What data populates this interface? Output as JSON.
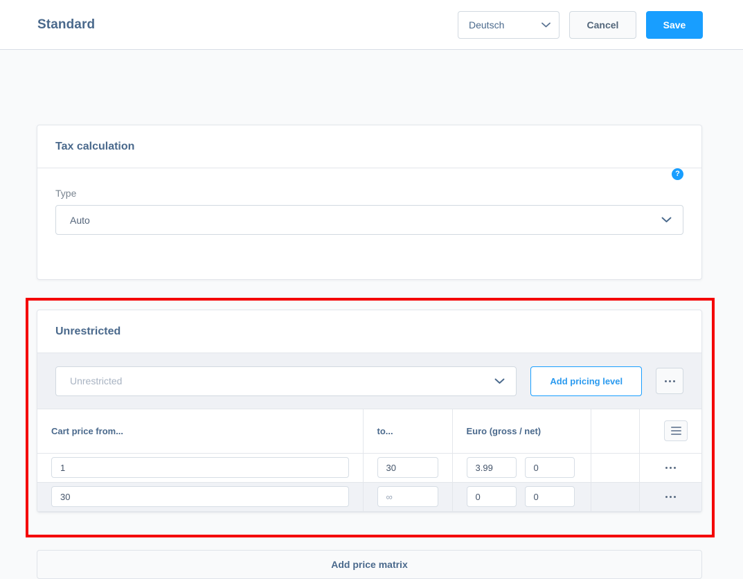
{
  "header": {
    "title": "Standard",
    "language": "Deutsch",
    "cancel_label": "Cancel",
    "save_label": "Save"
  },
  "tax_card": {
    "title": "Tax calculation",
    "type_label": "Type",
    "type_value": "Auto",
    "help_glyph": "?"
  },
  "unrestricted_card": {
    "title": "Unrestricted",
    "rule_select_value": "Unrestricted",
    "add_pricing_level_label": "Add pricing level",
    "table": {
      "headers": [
        "Cart price from...",
        "to...",
        "Euro (gross / net)",
        "",
        ""
      ],
      "rows": [
        {
          "from": "1",
          "to": "30",
          "gross": "3.99",
          "net": "0"
        },
        {
          "from": "30",
          "to": "∞",
          "gross": "0",
          "net": "0"
        }
      ]
    }
  },
  "footer": {
    "add_price_matrix_label": "Add price matrix"
  },
  "colors": {
    "accent": "#189eff",
    "highlight": "#f40000",
    "title_text": "#4a698c",
    "page_bg": "#f9fafb"
  }
}
